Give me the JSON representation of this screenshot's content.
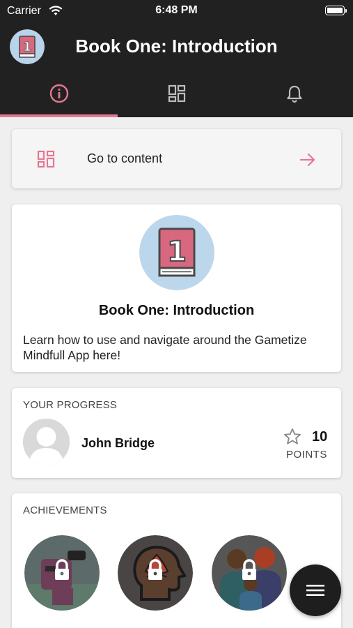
{
  "status_bar": {
    "carrier": "Carrier",
    "time": "6:48 PM"
  },
  "header": {
    "title": "Book One: Introduction",
    "avatar_icon": "book-one-icon"
  },
  "tabs": [
    {
      "name": "info",
      "icon": "info-icon",
      "active": true
    },
    {
      "name": "content",
      "icon": "dashboard-icon",
      "active": false
    },
    {
      "name": "notifications",
      "icon": "bell-icon",
      "active": false
    }
  ],
  "goto": {
    "label": "Go to content"
  },
  "intro": {
    "title": "Book One: Introduction",
    "description": "Learn how to use and navigate around the Gametize Mindfull App here!"
  },
  "progress": {
    "label": "YOUR PROGRESS",
    "user_name": "John Bridge",
    "points_value": "10",
    "points_label": "POINTS"
  },
  "achievements": {
    "label": "ACHIEVEMENTS",
    "items": [
      {
        "icon": "locked-character-icon",
        "locked": true
      },
      {
        "icon": "locked-lotus-head-icon",
        "locked": true
      },
      {
        "icon": "locked-family-icon",
        "locked": true
      }
    ]
  },
  "colors": {
    "accent": "#e57893",
    "header_bg": "#212121",
    "page_bg": "#efeff0"
  }
}
